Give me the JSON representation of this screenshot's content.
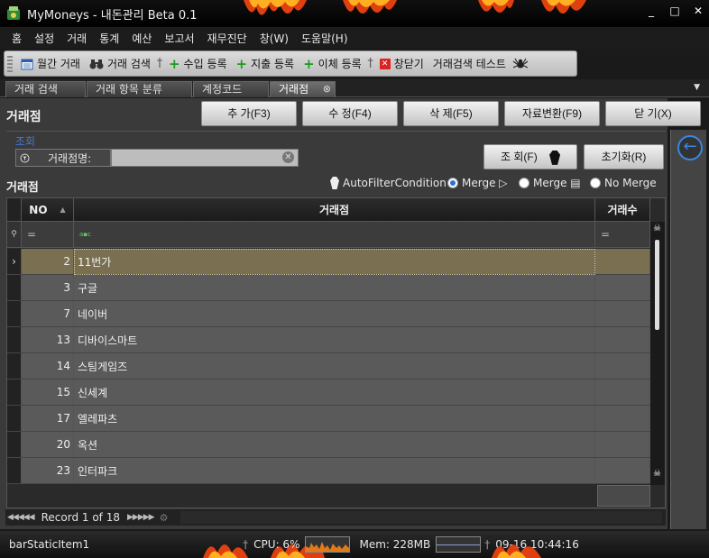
{
  "window": {
    "title": "MyMoneys - 내돈관리 Beta 0.1",
    "controls": [
      "_",
      "□",
      "✕"
    ]
  },
  "menu": [
    "홈",
    "설정",
    "거래",
    "통계",
    "예산",
    "보고서",
    "재무진단",
    "창(W)",
    "도움말(H)"
  ],
  "toolbar": {
    "monthly": "월간 거래",
    "search": "거래 검색",
    "income": "수입 등록",
    "expense": "지출 등록",
    "transfer": "이체 등록",
    "close": "창닫기",
    "test": "거래검색 테스트"
  },
  "tabs": [
    "거래 검색",
    "거래 항목 분류",
    "계정코드",
    "거래점"
  ],
  "active_tab": "거래점",
  "page": {
    "title": "거래점",
    "buttons": {
      "add": "추 가(F3)",
      "edit": "수 정(F4)",
      "delete": "삭 제(F5)",
      "convert": "자료변환(F9)",
      "close": "닫 기(X)"
    }
  },
  "query": {
    "group_label": "조회",
    "field_label": "거래점명:",
    "field_value": "",
    "search_button": "조 회(F)",
    "reset_button": "초기화(R)"
  },
  "grid": {
    "title": "거래점",
    "options": {
      "auto_filter": "AutoFilterCondition",
      "merge1": "Merge ▷",
      "merge2": "Merge ▤",
      "no_merge": "No Merge"
    },
    "columns": {
      "no": "NO",
      "name": "거래점",
      "count": "거래수"
    },
    "filter_no": "=",
    "filter_count": "=",
    "rows": [
      {
        "no": "2",
        "name": "11번가",
        "count": ""
      },
      {
        "no": "3",
        "name": "구글",
        "count": ""
      },
      {
        "no": "7",
        "name": "네이버",
        "count": ""
      },
      {
        "no": "13",
        "name": "디바이스마트",
        "count": ""
      },
      {
        "no": "14",
        "name": "스팀게임즈",
        "count": ""
      },
      {
        "no": "15",
        "name": "신세계",
        "count": ""
      },
      {
        "no": "17",
        "name": "엘레파츠",
        "count": ""
      },
      {
        "no": "20",
        "name": "옥션",
        "count": ""
      },
      {
        "no": "23",
        "name": "인터파크",
        "count": ""
      }
    ],
    "selected_index": 0
  },
  "navigator": {
    "record_text": "Record 1 of 18"
  },
  "status": {
    "static_item": "barStaticItem1",
    "cpu": "CPU: 6%",
    "mem": "Mem: 228MB",
    "datetime": "09-16 10:44:16"
  },
  "colors": {
    "accent": "#3b7bd9",
    "selected_row": "#7a7051",
    "row": "#5a5a5a"
  }
}
